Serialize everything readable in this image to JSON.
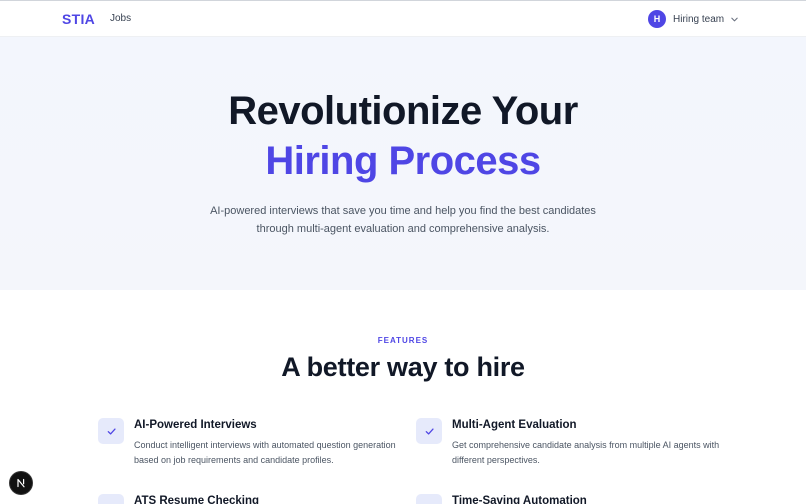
{
  "navbar": {
    "brand": "STIA",
    "links": [
      {
        "label": "Jobs"
      }
    ],
    "user": {
      "initial": "H",
      "name": "Hiring team"
    }
  },
  "hero": {
    "title_line1": "Revolutionize Your",
    "title_line2": "Hiring Process",
    "subtitle": "AI-powered interviews that save you time and help you find the best candidates through multi-agent evaluation and comprehensive analysis."
  },
  "features": {
    "eyebrow": "FEATURES",
    "title": "A better way to hire",
    "items": [
      {
        "title": "AI-Powered Interviews",
        "description": "Conduct intelligent interviews with automated question generation based on job requirements and candidate profiles.",
        "icon": "check-icon"
      },
      {
        "title": "Multi-Agent Evaluation",
        "description": "Get comprehensive candidate analysis from multiple AI agents with different perspectives.",
        "icon": "check-icon"
      },
      {
        "title": "ATS Resume Checking",
        "description": "",
        "icon": "check-icon"
      },
      {
        "title": "Time-Saving Automation",
        "description": "",
        "icon": "check-icon"
      }
    ]
  },
  "dev_badge": {
    "letter": "N"
  },
  "colors": {
    "accent": "#4f46e5",
    "text": "#111827",
    "muted": "#4b5563",
    "hero_bg": "#f3f6fd"
  }
}
